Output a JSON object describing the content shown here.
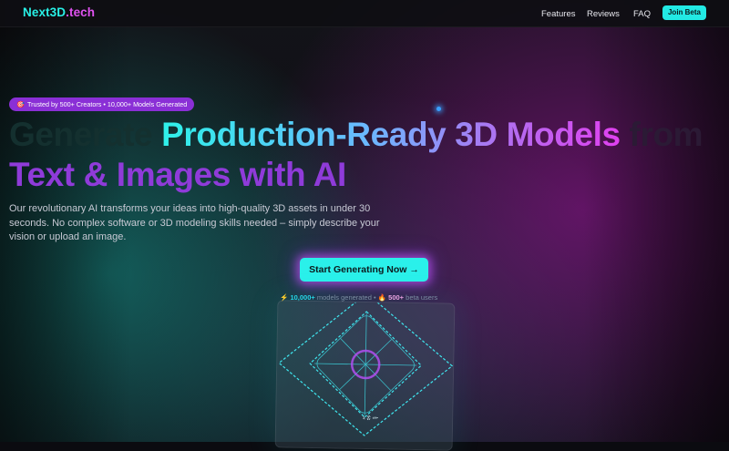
{
  "header": {
    "logo_main": "Next3D",
    "logo_suffix": ".tech",
    "nav": [
      "Features",
      "Reviews",
      "FAQ"
    ],
    "join_label": "Join Beta"
  },
  "hero": {
    "badge_icon": "🎯",
    "badge_text": "Trusted by 500+ Creators • 10,000+ Models Generated",
    "title_part1": "Generate ",
    "title_highlight": "Production-Ready 3D Models",
    "title_part2": " from",
    "title_line2": "Text & Images with AI",
    "description": "Our revolutionary AI transforms your ideas into high-quality 3D assets in under 30 seconds. No complex software or 3D modeling skills needed – simply describe your vision or upload an image.",
    "cta_label": "Start Generating Now →",
    "stats": {
      "icon1": "⚡",
      "count1": "10,000+",
      "label1": "models generated",
      "separator": "•",
      "icon2": "🔥",
      "count2": "500+",
      "label2": "beta users"
    },
    "preview_label": "ኒ ፰ ሙ"
  },
  "colors": {
    "accent_cyan": "#2af0ea",
    "accent_magenta": "#e040f0",
    "badge_purple": "#8a2fd6",
    "grid_line": "#3fe6ef"
  },
  "icons": {
    "badge": "target-icon",
    "stat1": "lightning-icon",
    "stat2": "fire-icon"
  }
}
